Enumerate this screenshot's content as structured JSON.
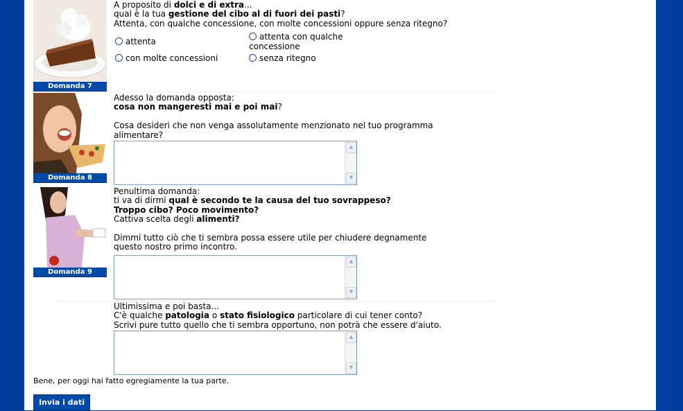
{
  "colors": {
    "background": "#003f9e",
    "label_bg": "#004aa8",
    "page": "#ffffff"
  },
  "q7": {
    "label": "Domanda 7",
    "l1a": "A proposito di ",
    "l1b": "dolci e di extra",
    "l1c": "...",
    "l2a": "qual è la tua ",
    "l2b": "gestione del cibo al di fuori dei pasti",
    "l2c": "?",
    "l3": "Attenta, con qualche concessione, con molte concessioni oppure senza ritegno?",
    "opt1": "attenta",
    "opt2a": "attenta con qualche",
    "opt2b": "concessione",
    "opt3": "con molte concessioni",
    "opt4": "senza ritegno"
  },
  "q8": {
    "label": "Domanda 8",
    "l1": "Adesso la domanda opposta:",
    "l2a": "cosa non mangeresti mai e poi mai",
    "l2b": "?",
    "l3": "Cosa desideri che non venga assolutamente menzionato nel tuo programma",
    "l4": "alimentare?"
  },
  "q9": {
    "label": "Domanda 9",
    "l1": "Penultima domanda:",
    "l2a": "ti va di dirmi ",
    "l2b": "qual è secondo te la causa del tuo sovrappeso?",
    "l3": "Troppo cibo? Poco movimento?",
    "l4a": "Cattiva scelta degli ",
    "l4b": "alimenti?",
    "l5": "Dimmi tutto ciò che ti sembra possa essere utile per chiudere degnamente",
    "l6": "questo nostro primo incontro."
  },
  "q10": {
    "l1": "Ultimissima e poi basta...",
    "l2a": "C'è qualche ",
    "l2b": "patologia",
    "l2c": " o ",
    "l2d": "stato fisiologico",
    "l2e": " particolare di cui tener conto?",
    "l3": "Scrivi pure tutto quello che ti sembra opportuno, non potrà che essere d'aiuto."
  },
  "footer": {
    "text": "Bene, per oggi hai fatto egregiamente la tua parte.",
    "submit": "Invia i dati"
  }
}
